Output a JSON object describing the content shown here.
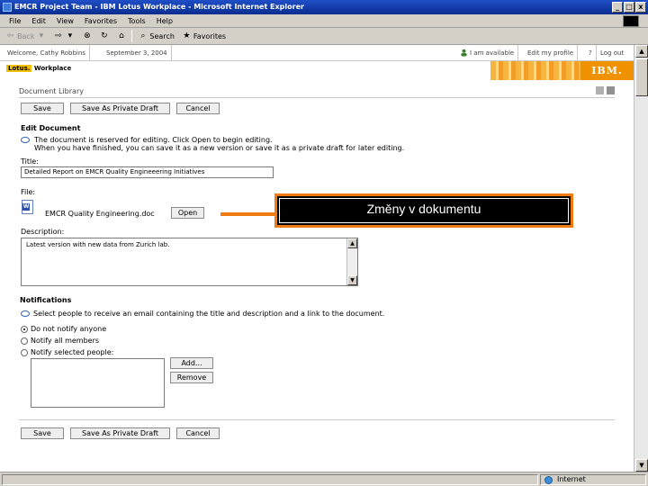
{
  "window": {
    "title": "EMCR Project Team - IBM Lotus Workplace - Microsoft Internet Explorer",
    "buttons": [
      "_",
      "□",
      "x"
    ]
  },
  "menu": [
    "File",
    "Edit",
    "View",
    "Favorites",
    "Tools",
    "Help"
  ],
  "toolbar": {
    "back": "Back",
    "search": "Search",
    "favorites": "Favorites"
  },
  "topbar": {
    "welcome": "Welcome, Cathy Robbins",
    "date": "September 3, 2004",
    "status": "I am available",
    "profile": "Edit my profile",
    "help": "?",
    "logout": "Log out"
  },
  "brand": {
    "lotus": "Lotus.",
    "product": "Workplace",
    "ibm": "IBM."
  },
  "panel": {
    "title": "Document Library"
  },
  "actions": {
    "save": "Save",
    "save_draft": "Save As Private Draft",
    "cancel": "Cancel"
  },
  "edit": {
    "heading": "Edit Document",
    "hint_line1": "The document is reserved for editing. Click Open to begin editing.",
    "hint_line2": "When you have finished, you can save it as a new version or save it as a private draft for later editing.",
    "title_label": "Title:",
    "title_value": "Detailed Report on EMCR Quality Engineeering Initiatives",
    "file_label": "File:",
    "file_name": "EMCR Quality Engineering.doc",
    "open_button": "Open",
    "description_label": "Description:",
    "description_value": "Latest version with new data from Zurich lab."
  },
  "notifications": {
    "heading": "Notifications",
    "hint": "Select people to receive an email containing the title and description and a link to the document.",
    "options": [
      "Do not notify anyone",
      "Notify all members",
      "Notify selected people:"
    ],
    "selected_index": 0,
    "add_button": "Add...",
    "remove_button": "Remove"
  },
  "callout": {
    "text": "Změny v dokumentu"
  },
  "statusbar": {
    "zone": "Internet"
  },
  "colors": {
    "callout_border": "#f07b12",
    "titlebar": "#0a2c8f",
    "ibm": "#f09100"
  }
}
